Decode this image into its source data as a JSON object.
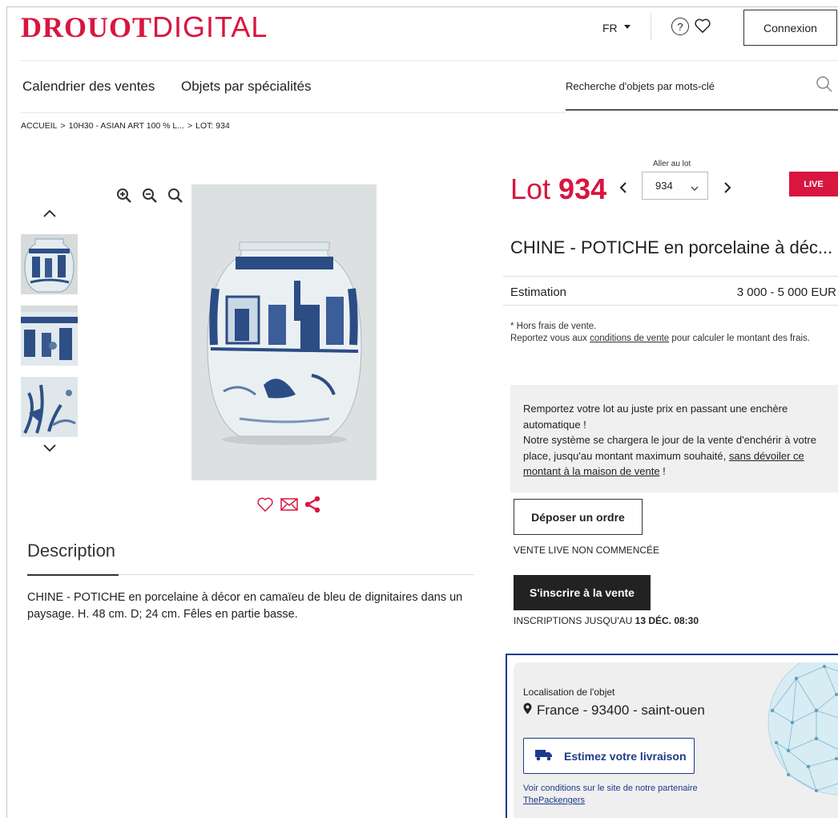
{
  "brand": {
    "logo_bold": "DROUOT",
    "logo_light": "DIGITAL",
    "color": "#d8163f"
  },
  "header": {
    "language": "FR",
    "help_symbol": "?",
    "help_icon": "question-circle-icon",
    "favorites_icon": "heart-icon",
    "login_label": "Connexion"
  },
  "nav": {
    "calendar": "Calendrier des ventes",
    "objects": "Objets par spécialités",
    "search_placeholder": "Recherche d'objets par mots-clé",
    "search_icon": "magnifier-icon"
  },
  "breadcrumb": {
    "home": "ACCUEIL",
    "sep1": ">",
    "sale": "10H30 - ASIAN ART 100 % L...",
    "sep2": ">",
    "lot": "LOT: 934"
  },
  "gallery": {
    "tools": [
      "zoom-in-icon",
      "zoom-out-icon",
      "zoom-reset-icon",
      "fullscreen-icon"
    ],
    "thumbnails": 3,
    "actions": [
      "heart-icon",
      "mail-icon",
      "share-icon"
    ]
  },
  "description": {
    "title": "Description",
    "text": "CHINE - POTICHE en porcelaine à décor en camaïeu de bleu de dignitaires dans un paysage. H. 48 cm. D; 24 cm. Fêles en partie basse."
  },
  "lot": {
    "prefix": "Lot ",
    "number": "934",
    "goto_label": "Aller au lot",
    "goto_value": "934",
    "live_badge": "LIVE",
    "title": "CHINE - POTICHE en porcelaine à déc...",
    "estimate_label": "Estimation",
    "estimate_value": "3 000 - 5 000 EUR",
    "fees_note": "* Hors frais de vente.",
    "fees_line_a": "Reportez vous aux ",
    "fees_link": "conditions de vente",
    "fees_line_b": " pour calculer le montant des frais."
  },
  "auto_bid": {
    "line1": "Remportez votre lot au juste prix en passant une enchère automatique !",
    "line2a": "Notre système se chargera le jour de la vente d'enchérir à votre place, jusqu'au montant maximum souhaité, ",
    "line2_link": "sans dévoiler ce montant à la maison de vente",
    "line2b": " !"
  },
  "actions": {
    "order_label": "Déposer un ordre",
    "live_status": "VENTE LIVE NON COMMENCÉE",
    "register_label": "S'inscrire à la vente",
    "deadline_prefix": "INSCRIPTIONS JUSQU'AU ",
    "deadline_value": "13 DÉC. 08:30"
  },
  "location": {
    "label": "Localisation de l'objet",
    "value": "France - 93400 - saint-ouen",
    "pin_icon": "map-pin-icon",
    "ship_label": "Estimez votre livraison",
    "ship_icon": "truck-icon",
    "note_text": "Voir conditions sur le site de notre partenaire ",
    "note_link": "ThePackengers",
    "accent": "#1e3a8a"
  }
}
